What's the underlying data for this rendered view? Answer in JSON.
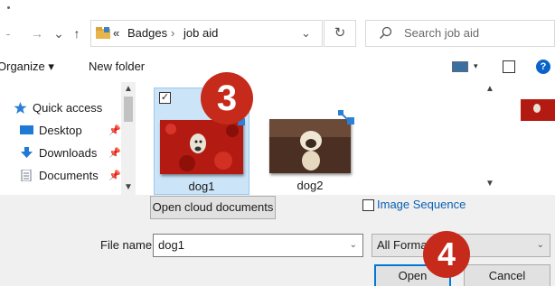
{
  "address": {
    "back_glyph": "←",
    "forward_glyph": "→",
    "recent_glyph": "⌄",
    "up_glyph": "↑",
    "overflow": "«",
    "crumb1": "Badges",
    "sep": "›",
    "crumb2": "job aid",
    "dropdown_glyph": "⌄",
    "refresh_glyph": "↻"
  },
  "search": {
    "placeholder": "Search job aid"
  },
  "toolbar": {
    "organize": "Organize ▾",
    "new_folder": "New folder",
    "view_arrow": "▾",
    "help": "?"
  },
  "nav": {
    "items": [
      {
        "label": "Quick access",
        "icon": "star-icon"
      },
      {
        "label": "Desktop",
        "icon": "desktop-icon",
        "pin": "📌"
      },
      {
        "label": "Downloads",
        "icon": "download-icon",
        "pin": "📌"
      },
      {
        "label": "Documents",
        "icon": "documents-icon",
        "pin": "📌"
      }
    ]
  },
  "files": [
    {
      "name": "dog1",
      "selected": true,
      "checked": "✓"
    },
    {
      "name": "dog2",
      "selected": false
    }
  ],
  "badges": {
    "step3": "3",
    "step4": "4"
  },
  "bottom": {
    "cloud_button": "Open cloud documents",
    "image_sequence": "Image Sequence",
    "file_name_label": "File name:",
    "file_name_value": "dog1",
    "file_type_value": "All Forma",
    "open": "Open",
    "cancel": "Cancel"
  },
  "colors": {
    "accent": "#0078d7",
    "badge": "#c62a1a",
    "selection": "#cce4f7",
    "link": "#0a5fb4"
  }
}
